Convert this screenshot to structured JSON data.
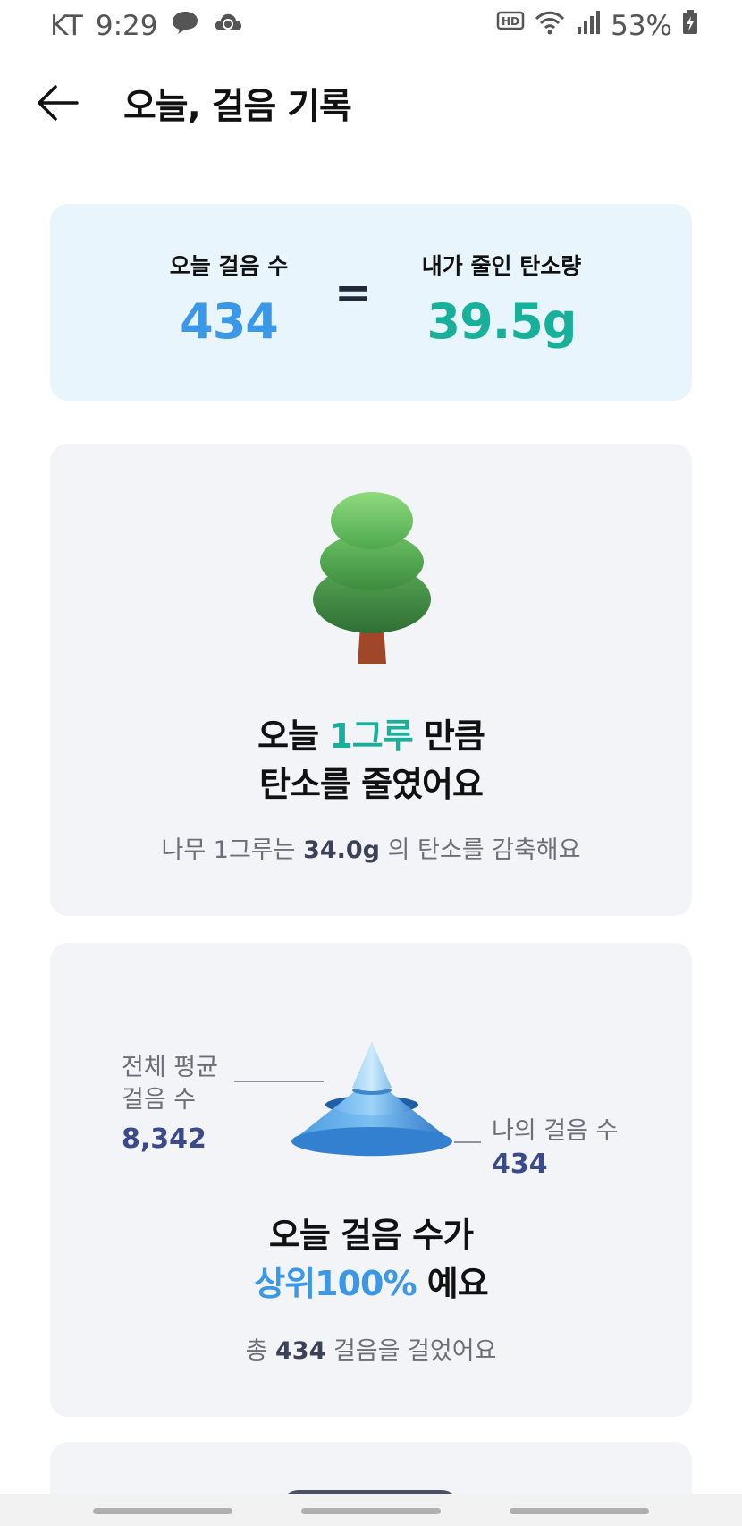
{
  "status_bar": {
    "carrier": "KT",
    "time": "9:29",
    "battery": "53%",
    "icons": [
      "chat-bubble-icon",
      "cloud-sync-icon",
      "hd-voice-icon",
      "wifi-icon",
      "signal-icon",
      "battery-charging-icon"
    ]
  },
  "header": {
    "back_icon": "arrow-left-icon",
    "title": "오늘, 걸음 기록"
  },
  "summary": {
    "steps_label": "오늘 걸음 수",
    "steps_value": "434",
    "equals": "=",
    "carbon_label": "내가 줄인 탄소량",
    "carbon_value": "39.5g",
    "colors": {
      "steps": "#3a98e6",
      "carbon": "#17b09a",
      "background": "#e9f5fd"
    }
  },
  "tree_card": {
    "illustration": "pine-tree-icon",
    "headline_prefix": "오늘 ",
    "headline_highlight": "1그루",
    "headline_suffix": " 만큼",
    "headline_line2": "탄소를 줄였어요",
    "sub_prefix": "나무 1그루는 ",
    "sub_value": "34.0g",
    "sub_suffix": " 의 탄소를 감축해요"
  },
  "rank_card": {
    "illustration": "pyramid-rank-icon",
    "avg_label_line1": "전체 평균",
    "avg_label_line2": "걸음 수",
    "avg_value": "8,342",
    "my_label": "나의 걸음 수",
    "my_value": "434",
    "headline_line1": "오늘 걸음 수가",
    "headline_highlight": "상위100%",
    "headline_suffix": " 예요",
    "sub_prefix": "총 ",
    "sub_value": "434",
    "sub_suffix": " 걸음을 걸었어요"
  },
  "nav": {
    "items": [
      "recent-apps",
      "home",
      "back"
    ]
  }
}
